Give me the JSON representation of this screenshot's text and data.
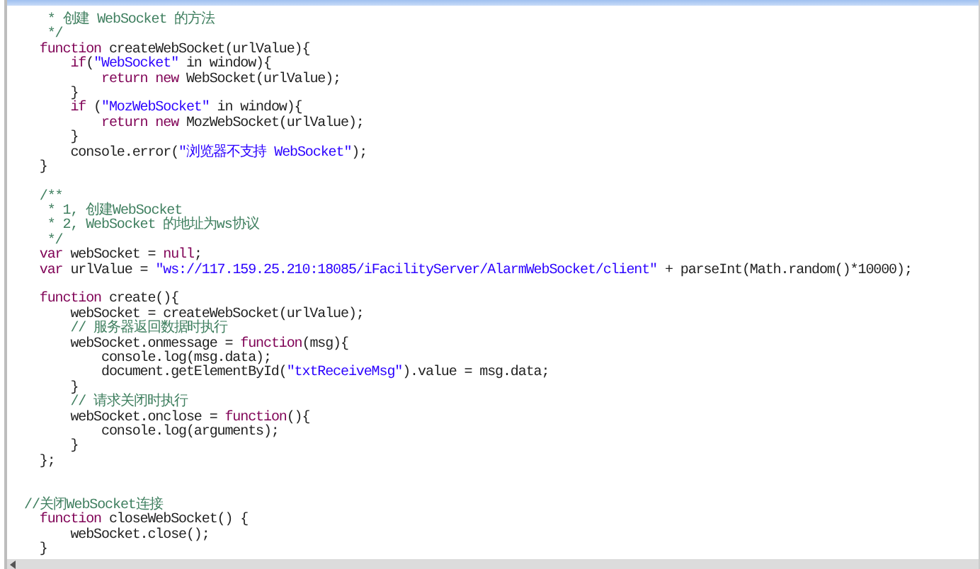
{
  "editor": {
    "lines": [
      {
        "kind": "code",
        "tokens": [
          {
            "kind": "comment",
            "text": "   * 创建 WebSocket 的方法"
          }
        ]
      },
      {
        "kind": "code",
        "tokens": [
          {
            "kind": "comment",
            "text": "   */"
          }
        ]
      },
      {
        "kind": "code",
        "tokens": [
          {
            "kind": "keyword",
            "text": "  function"
          },
          {
            "kind": "plain",
            "text": " createWebSocket(urlValue){"
          }
        ]
      },
      {
        "kind": "code",
        "tokens": [
          {
            "kind": "keyword",
            "text": "      if"
          },
          {
            "kind": "plain",
            "text": "("
          },
          {
            "kind": "string",
            "text": "\"WebSocket\""
          },
          {
            "kind": "plain",
            "text": " in window){"
          }
        ]
      },
      {
        "kind": "code",
        "tokens": [
          {
            "kind": "keyword",
            "text": "          return new"
          },
          {
            "kind": "plain",
            "text": " WebSocket(urlValue);"
          }
        ]
      },
      {
        "kind": "code",
        "tokens": [
          {
            "kind": "plain",
            "text": "      }"
          }
        ]
      },
      {
        "kind": "code",
        "tokens": [
          {
            "kind": "keyword",
            "text": "      if"
          },
          {
            "kind": "plain",
            "text": " ("
          },
          {
            "kind": "string",
            "text": "\"MozWebSocket\""
          },
          {
            "kind": "plain",
            "text": " in window){"
          }
        ]
      },
      {
        "kind": "code",
        "tokens": [
          {
            "kind": "keyword",
            "text": "          return new"
          },
          {
            "kind": "plain",
            "text": " MozWebSocket(urlValue);"
          }
        ]
      },
      {
        "kind": "code",
        "tokens": [
          {
            "kind": "plain",
            "text": "      }"
          }
        ]
      },
      {
        "kind": "code",
        "tokens": [
          {
            "kind": "plain",
            "text": "      console.error("
          },
          {
            "kind": "string",
            "text": "\"浏览器不支持 WebSocket\""
          },
          {
            "kind": "plain",
            "text": ");"
          }
        ]
      },
      {
        "kind": "code",
        "tokens": [
          {
            "kind": "plain",
            "text": "  }"
          }
        ]
      },
      {
        "kind": "blank"
      },
      {
        "kind": "code",
        "tokens": [
          {
            "kind": "comment",
            "text": "  /**"
          }
        ]
      },
      {
        "kind": "code",
        "tokens": [
          {
            "kind": "comment",
            "text": "   * 1, 创建WebSocket"
          }
        ]
      },
      {
        "kind": "code",
        "tokens": [
          {
            "kind": "comment",
            "text": "   * 2, WebSocket 的地址为ws协议"
          }
        ]
      },
      {
        "kind": "code",
        "tokens": [
          {
            "kind": "comment",
            "text": "   */"
          }
        ]
      },
      {
        "kind": "code",
        "tokens": [
          {
            "kind": "keyword",
            "text": "  var"
          },
          {
            "kind": "plain",
            "text": " webSocket = "
          },
          {
            "kind": "keyword",
            "text": "null"
          },
          {
            "kind": "plain",
            "text": ";"
          }
        ]
      },
      {
        "kind": "code",
        "tokens": [
          {
            "kind": "keyword",
            "text": "  var"
          },
          {
            "kind": "plain",
            "text": " urlValue = "
          },
          {
            "kind": "string",
            "text": "\"ws://117.159.25.210:18085/iFacilityServer/AlarmWebSocket/client\""
          },
          {
            "kind": "plain",
            "text": " + parseInt(Math.random()*10000);"
          }
        ]
      },
      {
        "kind": "blank"
      },
      {
        "kind": "code",
        "tokens": [
          {
            "kind": "keyword",
            "text": "  function"
          },
          {
            "kind": "plain",
            "text": " create(){"
          }
        ]
      },
      {
        "kind": "code",
        "tokens": [
          {
            "kind": "plain",
            "text": "      webSocket = createWebSocket(urlValue);"
          }
        ]
      },
      {
        "kind": "code",
        "tokens": [
          {
            "kind": "comment",
            "text": "      // 服务器返回数据时执行"
          }
        ]
      },
      {
        "kind": "code",
        "tokens": [
          {
            "kind": "plain",
            "text": "      webSocket.onmessage = "
          },
          {
            "kind": "keyword",
            "text": "function"
          },
          {
            "kind": "plain",
            "text": "(msg){"
          }
        ]
      },
      {
        "kind": "code",
        "tokens": [
          {
            "kind": "plain",
            "text": "          console.log(msg.data);"
          }
        ]
      },
      {
        "kind": "code",
        "tokens": [
          {
            "kind": "plain",
            "text": "          document.getElementById("
          },
          {
            "kind": "string",
            "text": "\"txtReceiveMsg\""
          },
          {
            "kind": "plain",
            "text": ").value = msg.data;"
          }
        ]
      },
      {
        "kind": "code",
        "tokens": [
          {
            "kind": "plain",
            "text": "      }"
          }
        ]
      },
      {
        "kind": "code",
        "tokens": [
          {
            "kind": "comment",
            "text": "      // 请求关闭时执行"
          }
        ]
      },
      {
        "kind": "code",
        "tokens": [
          {
            "kind": "plain",
            "text": "      webSocket.onclose = "
          },
          {
            "kind": "keyword",
            "text": "function"
          },
          {
            "kind": "plain",
            "text": "(){"
          }
        ]
      },
      {
        "kind": "code",
        "tokens": [
          {
            "kind": "plain",
            "text": "          console.log(arguments);"
          }
        ]
      },
      {
        "kind": "code",
        "tokens": [
          {
            "kind": "plain",
            "text": "      }"
          }
        ]
      },
      {
        "kind": "code",
        "tokens": [
          {
            "kind": "plain",
            "text": "  };"
          }
        ]
      },
      {
        "kind": "blank"
      },
      {
        "kind": "blank"
      },
      {
        "kind": "code",
        "tokens": [
          {
            "kind": "comment",
            "text": "//关闭WebSocket连接"
          }
        ]
      },
      {
        "kind": "code",
        "tokens": [
          {
            "kind": "keyword",
            "text": "  function"
          },
          {
            "kind": "plain",
            "text": " closeWebSocket() {"
          }
        ]
      },
      {
        "kind": "code",
        "tokens": [
          {
            "kind": "plain",
            "text": "      webSocket.close();"
          }
        ]
      },
      {
        "kind": "code",
        "tokens": [
          {
            "kind": "plain",
            "text": "  }"
          }
        ]
      }
    ]
  }
}
